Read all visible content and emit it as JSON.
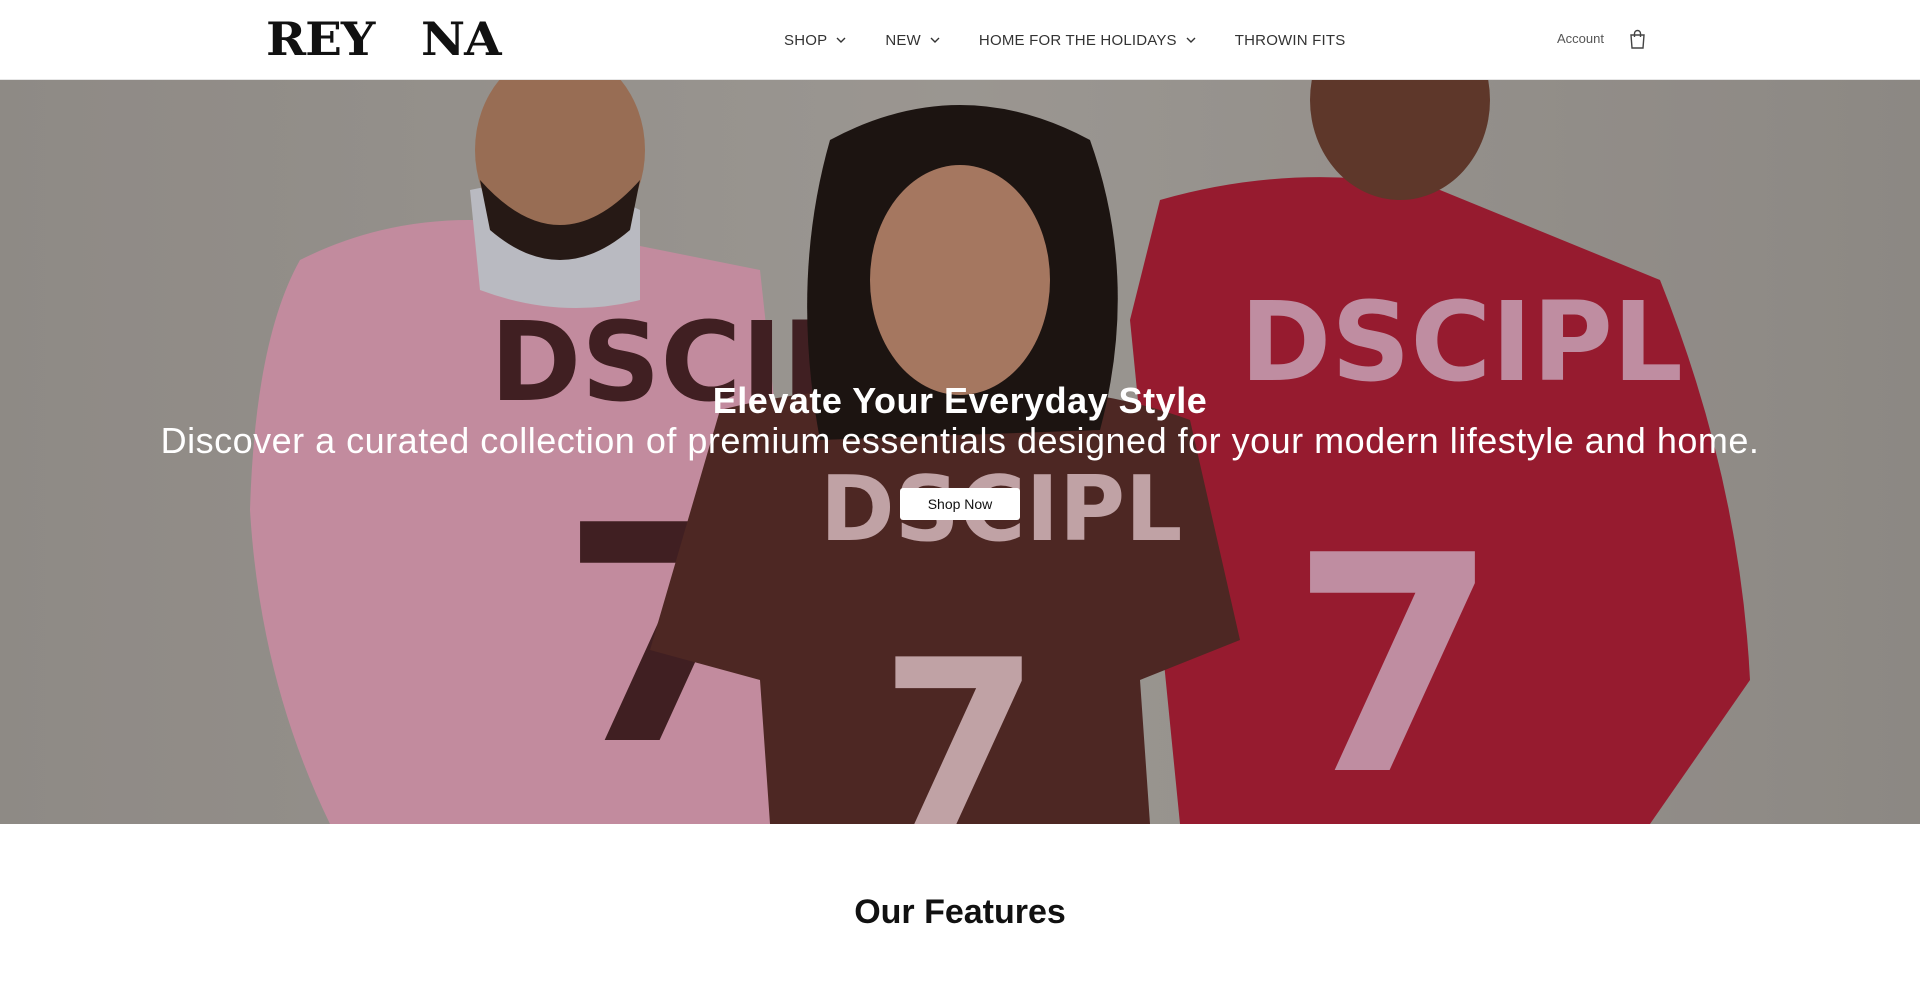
{
  "brand": {
    "logo_left": "REY",
    "logo_right": "NA"
  },
  "nav": {
    "items": [
      {
        "label": "SHOP",
        "has_dropdown": true
      },
      {
        "label": "NEW",
        "has_dropdown": true
      },
      {
        "label": "HOME FOR THE HOLIDAYS",
        "has_dropdown": true
      },
      {
        "label": "THROWIN FITS",
        "has_dropdown": false
      }
    ]
  },
  "header": {
    "account_label": "Account",
    "cart_icon": "shopping-bag-icon"
  },
  "hero": {
    "title": "Elevate Your Everyday Style",
    "subtitle": "Discover a curated collection of premium essentials designed for your modern lifestyle and home.",
    "cta_label": "Shop Now"
  },
  "features": {
    "title": "Our Features"
  },
  "colors": {
    "background": "#ffffff",
    "text": "#111111",
    "hero_overlay": "#b1aea8",
    "button_bg": "#ffffff"
  }
}
